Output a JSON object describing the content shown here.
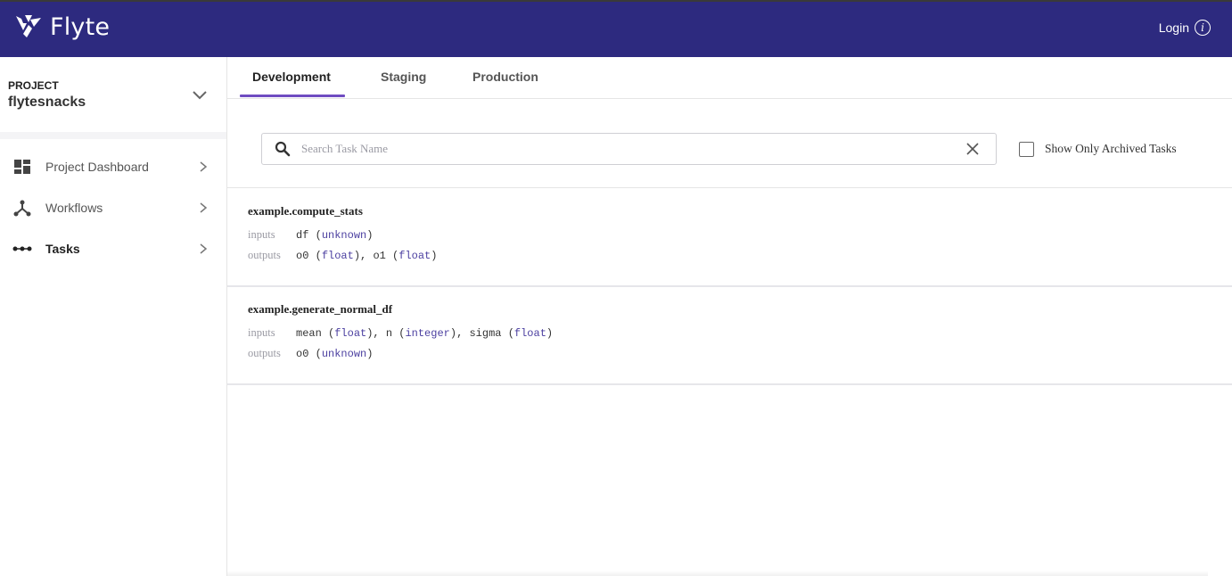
{
  "header": {
    "brand": "Flyte",
    "login_label": "Login",
    "info_glyph": "i",
    "accent_color": "#2d2a7f"
  },
  "sidebar": {
    "project_label": "PROJECT",
    "project_name": "flytesnacks",
    "items": [
      {
        "label": "Project Dashboard",
        "icon": "dashboard-icon",
        "active": false
      },
      {
        "label": "Workflows",
        "icon": "workflow-icon",
        "active": false
      },
      {
        "label": "Tasks",
        "icon": "tasks-icon",
        "active": true
      }
    ]
  },
  "tabs": [
    {
      "label": "Development",
      "active": true
    },
    {
      "label": "Staging",
      "active": false
    },
    {
      "label": "Production",
      "active": false
    }
  ],
  "search": {
    "placeholder": "Search Task Name",
    "value": "",
    "archived_checkbox_label": "Show Only Archived Tasks",
    "archived_checked": false
  },
  "tasks": [
    {
      "name": "example.compute_stats",
      "inputs_label": "inputs",
      "outputs_label": "outputs",
      "inputs": [
        {
          "name": "df",
          "type": "unknown"
        }
      ],
      "outputs": [
        {
          "name": "o0",
          "type": "float"
        },
        {
          "name": "o1",
          "type": "float"
        }
      ]
    },
    {
      "name": "example.generate_normal_df",
      "inputs_label": "inputs",
      "outputs_label": "outputs",
      "inputs": [
        {
          "name": "mean",
          "type": "float"
        },
        {
          "name": "n",
          "type": "integer"
        },
        {
          "name": "sigma",
          "type": "float"
        }
      ],
      "outputs": [
        {
          "name": "o0",
          "type": "unknown"
        }
      ]
    }
  ]
}
